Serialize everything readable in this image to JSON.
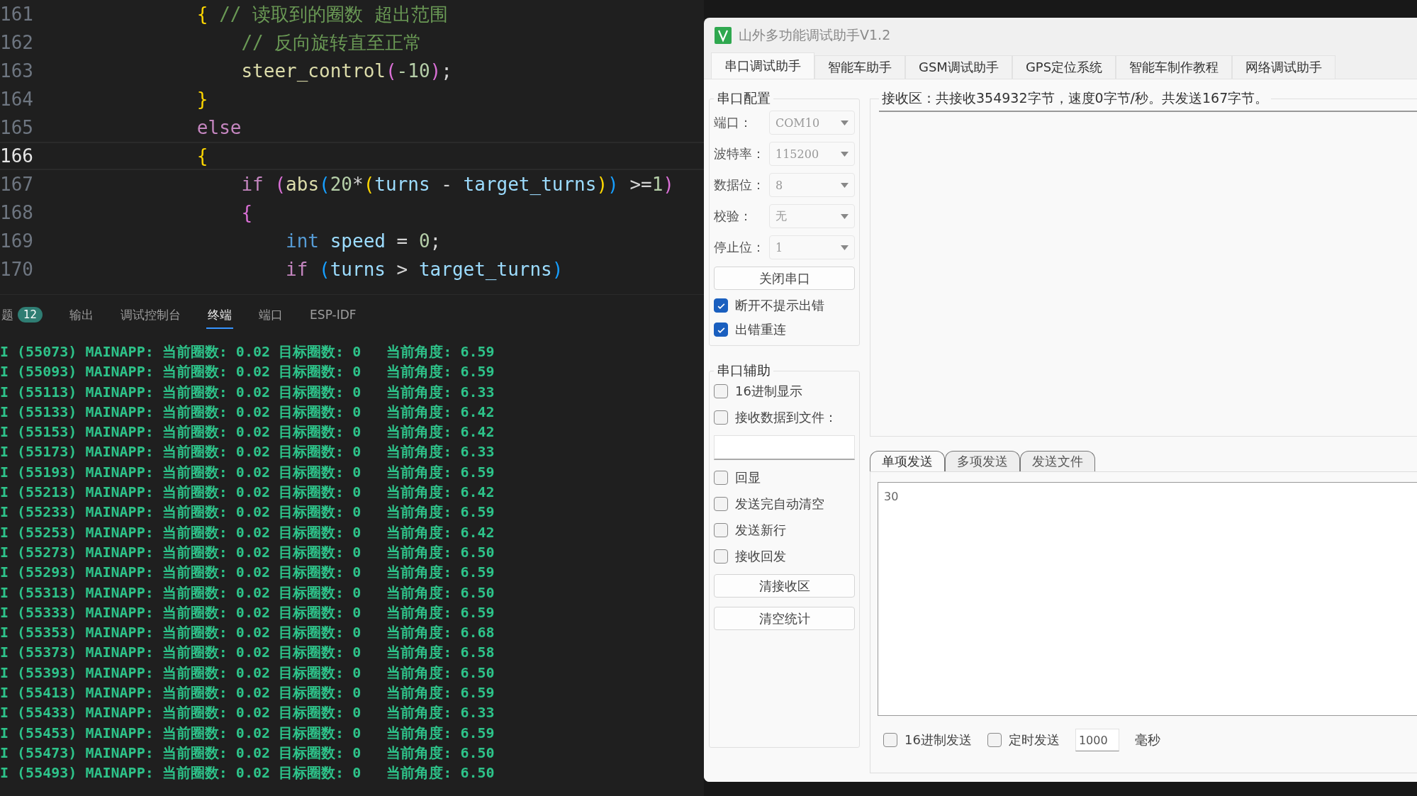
{
  "editor": {
    "lines": [
      {
        "number": "161",
        "current": false,
        "tokens": [
          {
            "text": "            {",
            "kind": "brace1"
          },
          {
            "text": " // 读取到的圈数 超出范围",
            "kind": "comment"
          }
        ]
      },
      {
        "number": "162",
        "current": false,
        "tokens": [
          {
            "text": "                // 反向旋转直至正常",
            "kind": "comment"
          }
        ]
      },
      {
        "number": "163",
        "current": false,
        "tokens": [
          {
            "text": "                steer_control",
            "kind": "function"
          },
          {
            "text": "(",
            "kind": "brace2"
          },
          {
            "text": "-10",
            "kind": "number"
          },
          {
            "text": ")",
            "kind": "brace2"
          },
          {
            "text": ";",
            "kind": "plain"
          }
        ]
      },
      {
        "number": "164",
        "current": false,
        "tokens": [
          {
            "text": "            }",
            "kind": "brace1"
          }
        ]
      },
      {
        "number": "165",
        "current": false,
        "tokens": [
          {
            "text": "            else",
            "kind": "control"
          }
        ]
      },
      {
        "number": "166",
        "current": true,
        "tokens": [
          {
            "text": "            {",
            "kind": "brace1"
          }
        ]
      },
      {
        "number": "167",
        "current": false,
        "tokens": [
          {
            "text": "                if",
            "kind": "control"
          },
          {
            "text": " (",
            "kind": "brace2"
          },
          {
            "text": "abs",
            "kind": "function"
          },
          {
            "text": "(",
            "kind": "brace3"
          },
          {
            "text": "20",
            "kind": "number"
          },
          {
            "text": "*",
            "kind": "plain"
          },
          {
            "text": "(",
            "kind": "brace1"
          },
          {
            "text": "turns",
            "kind": "variable"
          },
          {
            "text": " - ",
            "kind": "plain"
          },
          {
            "text": "target_turns",
            "kind": "variable"
          },
          {
            "text": ")",
            "kind": "brace1"
          },
          {
            "text": ")",
            "kind": "brace3"
          },
          {
            "text": " >=",
            "kind": "plain"
          },
          {
            "text": "1",
            "kind": "number"
          },
          {
            "text": ")",
            "kind": "brace2"
          }
        ]
      },
      {
        "number": "168",
        "current": false,
        "tokens": [
          {
            "text": "                {",
            "kind": "brace2"
          }
        ]
      },
      {
        "number": "169",
        "current": false,
        "tokens": [
          {
            "text": "                    int",
            "kind": "type"
          },
          {
            "text": " speed",
            "kind": "variable"
          },
          {
            "text": " = ",
            "kind": "plain"
          },
          {
            "text": "0",
            "kind": "number"
          },
          {
            "text": ";",
            "kind": "plain"
          }
        ]
      },
      {
        "number": "170",
        "current": false,
        "tokens": [
          {
            "text": "                    if",
            "kind": "control"
          },
          {
            "text": " (",
            "kind": "brace3"
          },
          {
            "text": "turns",
            "kind": "variable"
          },
          {
            "text": " > ",
            "kind": "plain"
          },
          {
            "text": "target_turns",
            "kind": "variable"
          },
          {
            "text": ")",
            "kind": "brace3"
          }
        ]
      }
    ]
  },
  "panel": {
    "tabs": [
      {
        "label": "题",
        "badge": "12",
        "selected": false
      },
      {
        "label": "输出",
        "selected": false
      },
      {
        "label": "调试控制台",
        "selected": false
      },
      {
        "label": "终端",
        "selected": true
      },
      {
        "label": "端口",
        "selected": false
      },
      {
        "label": "ESP-IDF",
        "selected": false
      }
    ]
  },
  "terminal": {
    "lines": [
      "I (55073) MAINAPP: 当前圈数: 0.02 目标圈数: 0   当前角度: 6.59",
      "I (55093) MAINAPP: 当前圈数: 0.02 目标圈数: 0   当前角度: 6.59",
      "I (55113) MAINAPP: 当前圈数: 0.02 目标圈数: 0   当前角度: 6.33",
      "I (55133) MAINAPP: 当前圈数: 0.02 目标圈数: 0   当前角度: 6.42",
      "I (55153) MAINAPP: 当前圈数: 0.02 目标圈数: 0   当前角度: 6.42",
      "I (55173) MAINAPP: 当前圈数: 0.02 目标圈数: 0   当前角度: 6.33",
      "I (55193) MAINAPP: 当前圈数: 0.02 目标圈数: 0   当前角度: 6.59",
      "I (55213) MAINAPP: 当前圈数: 0.02 目标圈数: 0   当前角度: 6.42",
      "I (55233) MAINAPP: 当前圈数: 0.02 目标圈数: 0   当前角度: 6.59",
      "I (55253) MAINAPP: 当前圈数: 0.02 目标圈数: 0   当前角度: 6.42",
      "I (55273) MAINAPP: 当前圈数: 0.02 目标圈数: 0   当前角度: 6.50",
      "I (55293) MAINAPP: 当前圈数: 0.02 目标圈数: 0   当前角度: 6.59",
      "I (55313) MAINAPP: 当前圈数: 0.02 目标圈数: 0   当前角度: 6.50",
      "I (55333) MAINAPP: 当前圈数: 0.02 目标圈数: 0   当前角度: 6.59",
      "I (55353) MAINAPP: 当前圈数: 0.02 目标圈数: 0   当前角度: 6.68",
      "I (55373) MAINAPP: 当前圈数: 0.02 目标圈数: 0   当前角度: 6.58",
      "I (55393) MAINAPP: 当前圈数: 0.02 目标圈数: 0   当前角度: 6.50",
      "I (55413) MAINAPP: 当前圈数: 0.02 目标圈数: 0   当前角度: 6.59",
      "I (55433) MAINAPP: 当前圈数: 0.02 目标圈数: 0   当前角度: 6.33",
      "I (55453) MAINAPP: 当前圈数: 0.02 目标圈数: 0   当前角度: 6.59",
      "I (55473) MAINAPP: 当前圈数: 0.02 目标圈数: 0   当前角度: 6.50",
      "I (55493) MAINAPP: 当前圈数: 0.02 目标圈数: 0   当前角度: 6.50"
    ]
  },
  "serial_tool": {
    "title": "山外多功能调试助手V1.2",
    "tabs": [
      {
        "label": "串口调试助手",
        "selected": true
      },
      {
        "label": "智能车助手",
        "selected": false
      },
      {
        "label": "GSM调试助手",
        "selected": false
      },
      {
        "label": "GPS定位系统",
        "selected": false
      },
      {
        "label": "智能车制作教程",
        "selected": false
      },
      {
        "label": "网络调试助手",
        "selected": false
      }
    ],
    "config": {
      "title": "串口配置",
      "fields": [
        {
          "label": "端口：",
          "value": "COM10"
        },
        {
          "label": "波特率：",
          "value": "115200"
        },
        {
          "label": "数据位：",
          "value": "8"
        },
        {
          "label": "校验：",
          "value": "无"
        },
        {
          "label": "停止位：",
          "value": "1"
        }
      ],
      "button": "关闭串口",
      "options": [
        {
          "label": "断开不提示出错",
          "checked": true
        },
        {
          "label": "出错重连",
          "checked": true
        }
      ]
    },
    "assist": {
      "title": "串口辅助",
      "items": [
        {
          "kind": "checkbox",
          "label": "16进制显示",
          "checked": false
        },
        {
          "kind": "checkbox",
          "label": "接收数据到文件：",
          "checked": false
        },
        {
          "kind": "field"
        },
        {
          "kind": "checkbox",
          "label": "回显",
          "checked": false
        },
        {
          "kind": "checkbox",
          "label": "发送完自动清空",
          "checked": false
        },
        {
          "kind": "checkbox",
          "label": "发送新行",
          "checked": false
        },
        {
          "kind": "checkbox",
          "label": "接收回发",
          "checked": false
        },
        {
          "kind": "button",
          "label": "清接收区"
        },
        {
          "kind": "button",
          "label": "清空统计"
        }
      ]
    },
    "receive": {
      "title": "接收区：共接收354932字节，速度0字节/秒。共发送167字节。"
    },
    "send_tabs": [
      {
        "label": "单项发送",
        "selected": true
      },
      {
        "label": "多项发送",
        "selected": false
      },
      {
        "label": "发送文件",
        "selected": false
      }
    ],
    "send_text": "30",
    "send_options": [
      {
        "label": "16进制发送",
        "checked": false
      },
      {
        "label": "定时发送",
        "checked": false
      }
    ],
    "interval": "1000",
    "interval_unit": "毫秒"
  }
}
